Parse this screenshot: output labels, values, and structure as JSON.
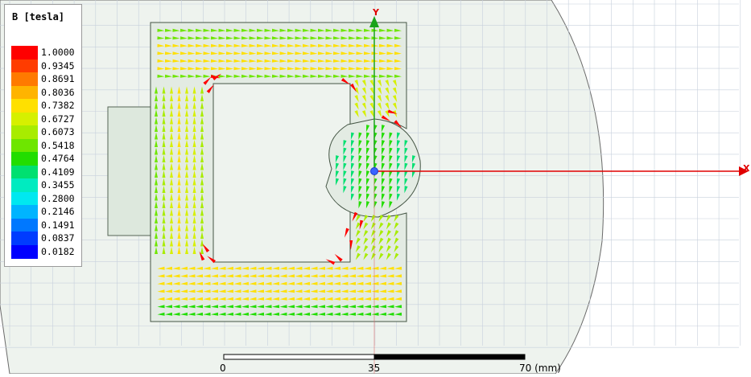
{
  "legend": {
    "title": "B [tesla]",
    "levels": [
      "1.0000",
      "0.9345",
      "0.8691",
      "0.8036",
      "0.7382",
      "0.6727",
      "0.6073",
      "0.5418",
      "0.4764",
      "0.4109",
      "0.3455",
      "0.2800",
      "0.2146",
      "0.1491",
      "0.0837",
      "0.0182"
    ],
    "colors": [
      "#ff0000",
      "#ff3c00",
      "#ff7a00",
      "#ffb400",
      "#ffe000",
      "#d6f000",
      "#a8ec00",
      "#6ee600",
      "#22dd00",
      "#00e070",
      "#00ebc0",
      "#00e8f0",
      "#00b4ff",
      "#0078ff",
      "#003cff",
      "#0000ff"
    ]
  },
  "axes": {
    "x_label": "X",
    "y_label": "Y"
  },
  "scale_bar": {
    "labels": [
      "0",
      "35",
      "70 (mm)"
    ]
  },
  "colors": {
    "background": "#eef3ee",
    "grid": "#c2cbd8",
    "axis": "#e00000",
    "origin": "#3a64ff",
    "y_axis": "#1aa31a"
  }
}
